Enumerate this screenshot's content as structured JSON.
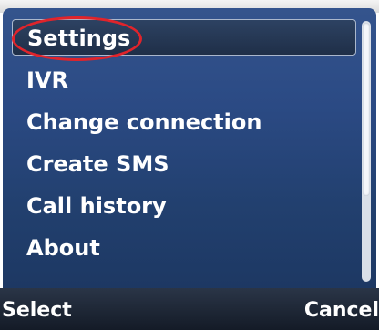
{
  "menu": {
    "items": [
      {
        "label": "Settings"
      },
      {
        "label": "IVR"
      },
      {
        "label": "Change connection"
      },
      {
        "label": "Create SMS"
      },
      {
        "label": "Call history"
      },
      {
        "label": "About"
      }
    ],
    "selected_index": 0
  },
  "softkeys": {
    "left": "Select",
    "right": "Cancel"
  },
  "colors": {
    "panel": "#2b4a84",
    "highlight_ring": "#e0242b",
    "softkey_bar": "#1c2433"
  }
}
